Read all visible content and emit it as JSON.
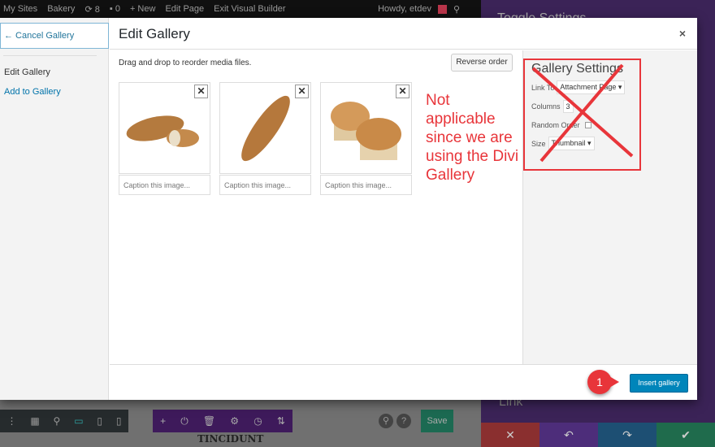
{
  "adminbar": {
    "my_sites": "My Sites",
    "site": "Bakery",
    "updates": "8",
    "comments": "0",
    "new": "New",
    "edit_page": "Edit Page",
    "exit": "Exit Visual Builder",
    "howdy": "Howdy, etdev"
  },
  "right_panel": {
    "title": "Toggle Settings",
    "link_label": "Link"
  },
  "sidebar": {
    "cancel": "← Cancel Gallery",
    "items": [
      {
        "label": "Edit Gallery"
      },
      {
        "label": "Add to Gallery"
      }
    ]
  },
  "modal": {
    "title": "Edit Gallery",
    "close": "×",
    "hint": "Drag and drop to reorder media files.",
    "reverse": "Reverse order",
    "images": [
      {
        "alt": "baguette pieces",
        "caption_placeholder": "Caption this image..."
      },
      {
        "alt": "baguette",
        "caption_placeholder": "Caption this image..."
      },
      {
        "alt": "muffins",
        "caption_placeholder": "Caption this image..."
      }
    ],
    "annotation": "Not applicable since we are using the Divi Gallery",
    "settings": {
      "title": "Gallery Settings",
      "link_to_label": "Link To",
      "link_to_value": "Attachment Page",
      "columns_label": "Columns",
      "columns_value": "3",
      "random_label": "Random Order",
      "random_checked": false,
      "size_label": "Size",
      "size_value": "Thumbnail"
    },
    "insert": "Insert gallery",
    "callout": "1"
  },
  "builder": {
    "save": "Save",
    "module_text": "TINCIDUNT"
  },
  "colors": {
    "accent": "#0085ba",
    "annotation": "#e8353a"
  }
}
